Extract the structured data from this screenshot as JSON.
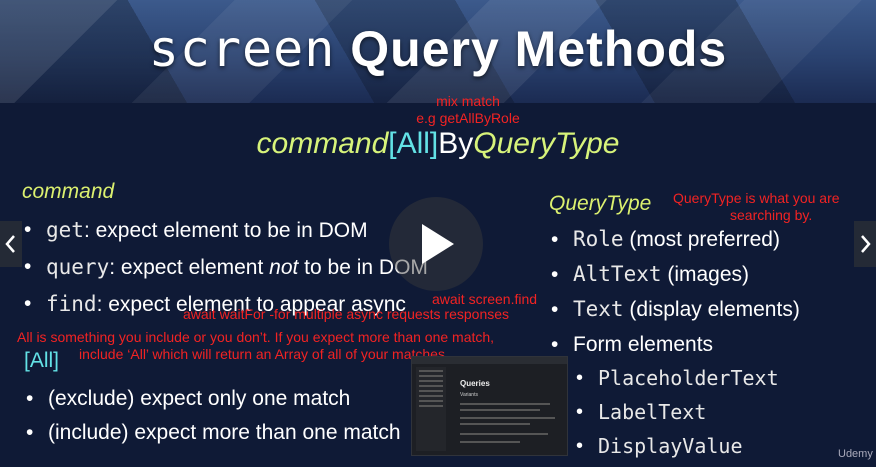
{
  "title": {
    "mono": "screen",
    "bold": "Query Methods"
  },
  "annotations": {
    "mix_line1": "mix match",
    "mix_line2": "e.g getAllByRole",
    "querytype_note_line1": "QueryType is what you are",
    "querytype_note_line2": "searching by.",
    "await_line1": "await  screen.find",
    "await_line2": "await waitFor -for multiple async requests responses",
    "all_line1": "All is something you include or you don’t. If you expect more than one match,",
    "all_line2": "include ‘All’ which will return an Array of all of your matches"
  },
  "syntax": {
    "command": "command",
    "all": "[All]",
    "by": "By",
    "querytype": "QueryType"
  },
  "command_section": {
    "heading": "command",
    "items": [
      {
        "code": "get",
        "text": ": expect element to be in DOM"
      },
      {
        "code": "query",
        "text_before": ": expect element ",
        "emph": "not",
        "text_after": " to be in DOM"
      },
      {
        "code": "find",
        "text": ": expect element to appear async"
      }
    ]
  },
  "all_section": {
    "heading": "[All]",
    "items": [
      "(exclude) expect only one match",
      "(include) expect more than one match"
    ]
  },
  "querytype_section": {
    "heading": "QueryType",
    "items": [
      {
        "code": "Role",
        "text": " (most preferred)"
      },
      {
        "code": "AltText",
        "text": " (images)"
      },
      {
        "code": "Text",
        "text": " (display elements)"
      },
      {
        "text": "Form elements"
      }
    ],
    "subitems": [
      "PlaceholderText",
      "LabelText",
      "DisplayValue"
    ]
  },
  "thumbnail": {
    "heading": "Queries",
    "sub": "Variants"
  },
  "player": {
    "logo": "Udemy"
  },
  "icons": {
    "prev": "chevron-left-icon",
    "next": "chevron-right-icon",
    "play": "play-icon"
  }
}
